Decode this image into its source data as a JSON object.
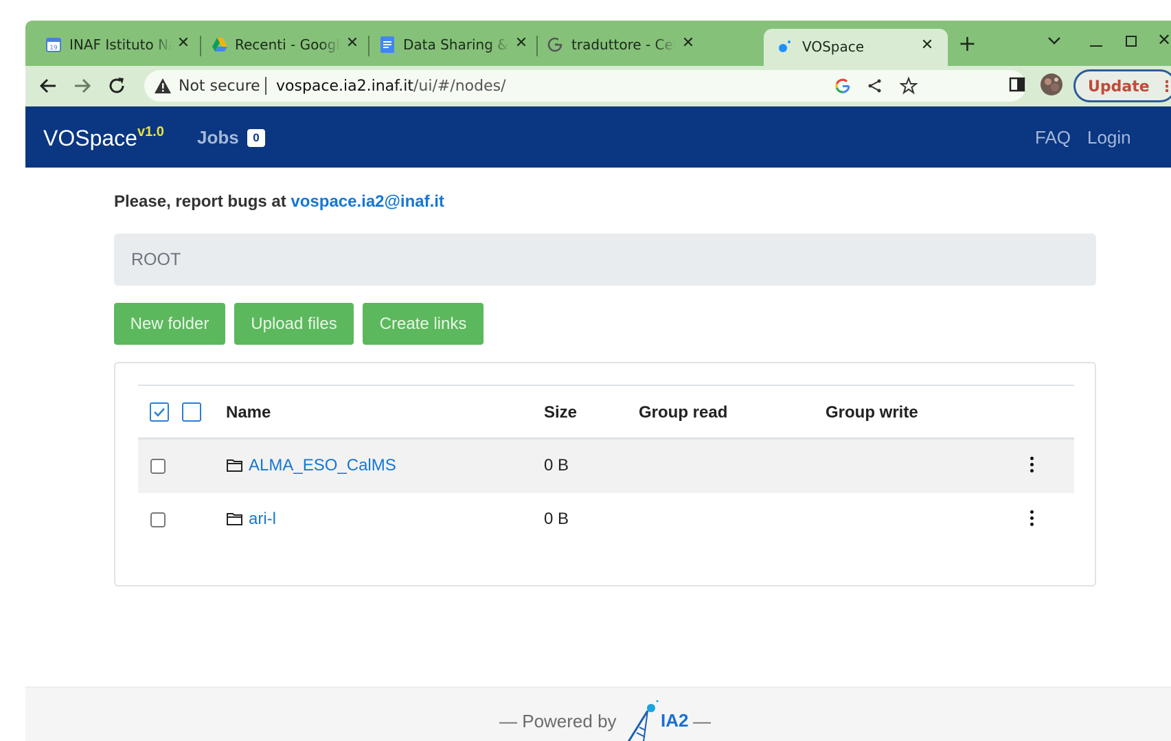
{
  "browser": {
    "tabs": [
      {
        "title": "INAF Istituto Nazi",
        "icon": "calendar-icon"
      },
      {
        "title": "Recenti - Google I",
        "icon": "drive-icon"
      },
      {
        "title": "Data Sharing & Pr",
        "icon": "docs-icon"
      },
      {
        "title": "traduttore - Cerca",
        "icon": "google-icon"
      },
      {
        "title": "VOSpace",
        "icon": "vospace-icon",
        "active": true
      }
    ],
    "address": {
      "security_label": "Not secure",
      "url_host": "vospace.ia2.inaf.it",
      "url_path": "/ui/#/nodes/"
    },
    "update_label": "Update",
    "colors": {
      "frame": "#86c17a",
      "toolbar": "#d9ecd3"
    }
  },
  "navbar": {
    "brand": "VOSpace",
    "version": "v1.0",
    "jobs_label": "Jobs",
    "jobs_count": "0",
    "faq_label": "FAQ",
    "login_label": "Login",
    "color": "#0a3682"
  },
  "notice": {
    "prefix": "Please, report bugs at",
    "email": "vospace.ia2@inaf.it"
  },
  "breadcrumb": {
    "root": "ROOT"
  },
  "actions": {
    "new_folder": "New folder",
    "upload_files": "Upload files",
    "create_links": "Create links",
    "color": "#5cb85c"
  },
  "table": {
    "columns": {
      "name": "Name",
      "size": "Size",
      "group_read": "Group read",
      "group_write": "Group write"
    },
    "rows": [
      {
        "name": "ALMA_ESO_CalMS",
        "size": "0 B",
        "group_read": "",
        "group_write": "",
        "type": "folder"
      },
      {
        "name": "ari-l",
        "size": "0 B",
        "group_read": "",
        "group_write": "",
        "type": "folder"
      }
    ]
  },
  "footer": {
    "powered_by": "— Powered by",
    "logo_text": "IA2",
    "trailing": "—"
  }
}
